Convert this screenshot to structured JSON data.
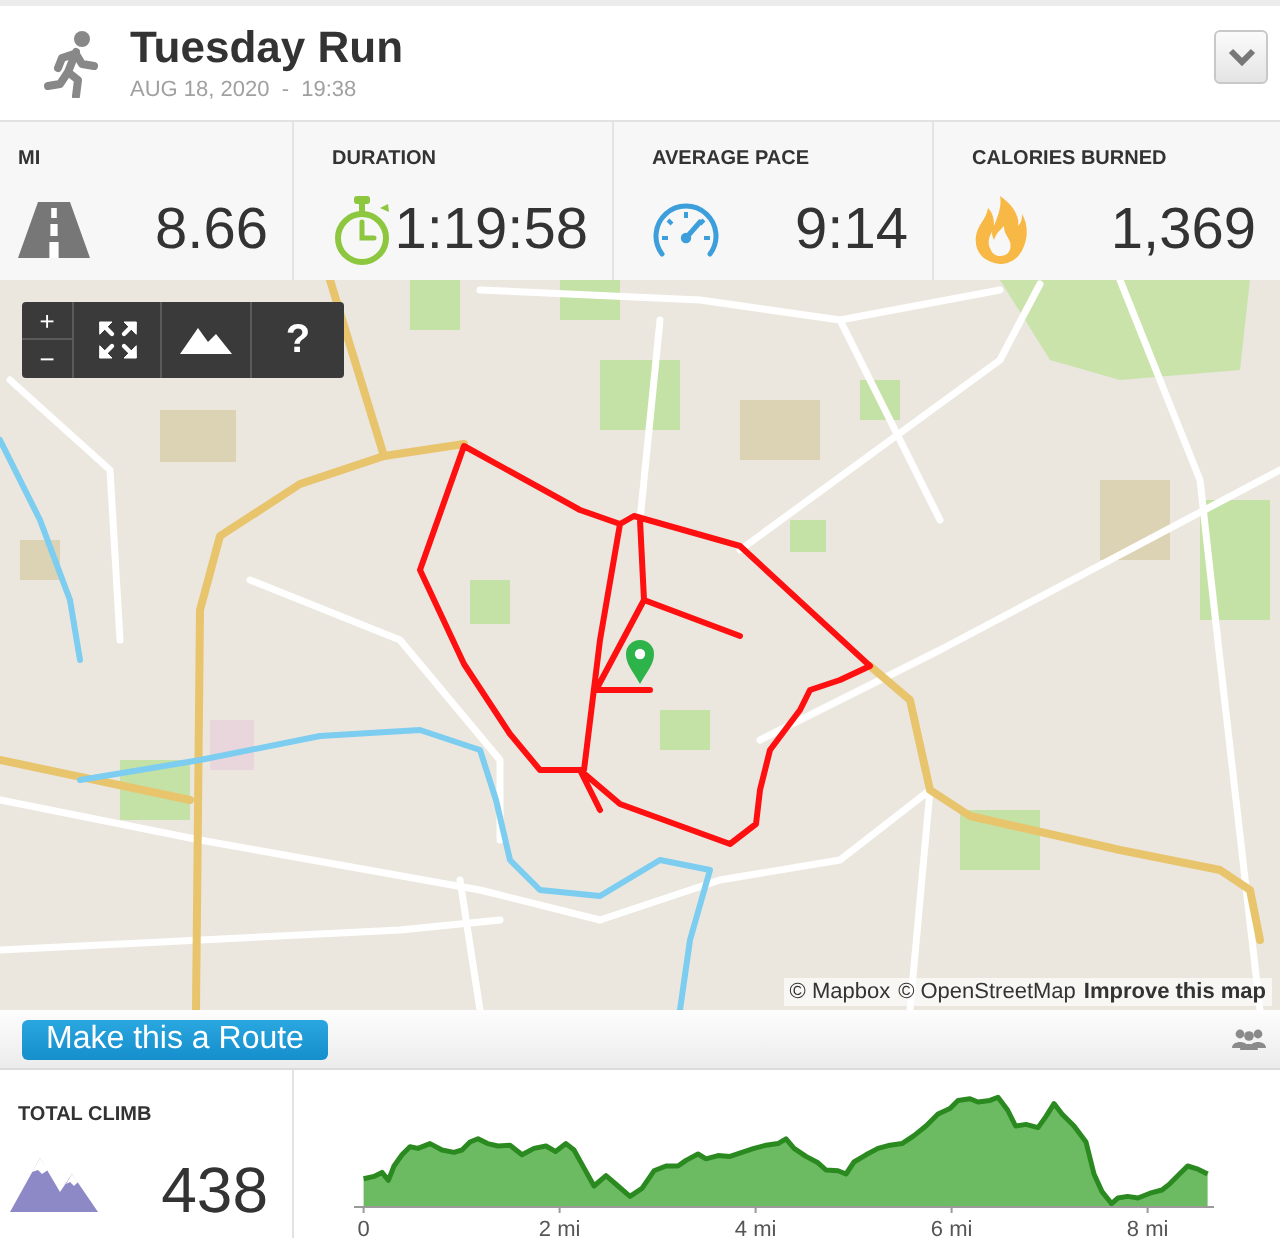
{
  "header": {
    "title": "Tuesday Run",
    "date": "AUG 18, 2020  -  19:38"
  },
  "stats": [
    {
      "kind": "distance",
      "label": "MI",
      "value": "8.66"
    },
    {
      "kind": "duration",
      "label": "DURATION",
      "value": "1:19:58"
    },
    {
      "kind": "pace",
      "label": "AVERAGE PACE",
      "value": "9:14"
    },
    {
      "kind": "calories",
      "label": "CALORIES BURNED",
      "value": "1,369"
    }
  ],
  "map": {
    "zoom_in": "+",
    "zoom_out": "−",
    "help": "?",
    "attribution": [
      "© Mapbox",
      "© OpenStreetMap",
      "Improve this map"
    ]
  },
  "route_bar": {
    "button": "Make this a Route"
  },
  "climb": {
    "label": "TOTAL CLIMB",
    "value": "438"
  },
  "elevation": {
    "x_labels": [
      "0",
      "2 mi",
      "4 mi",
      "6 mi",
      "8 mi"
    ]
  }
}
